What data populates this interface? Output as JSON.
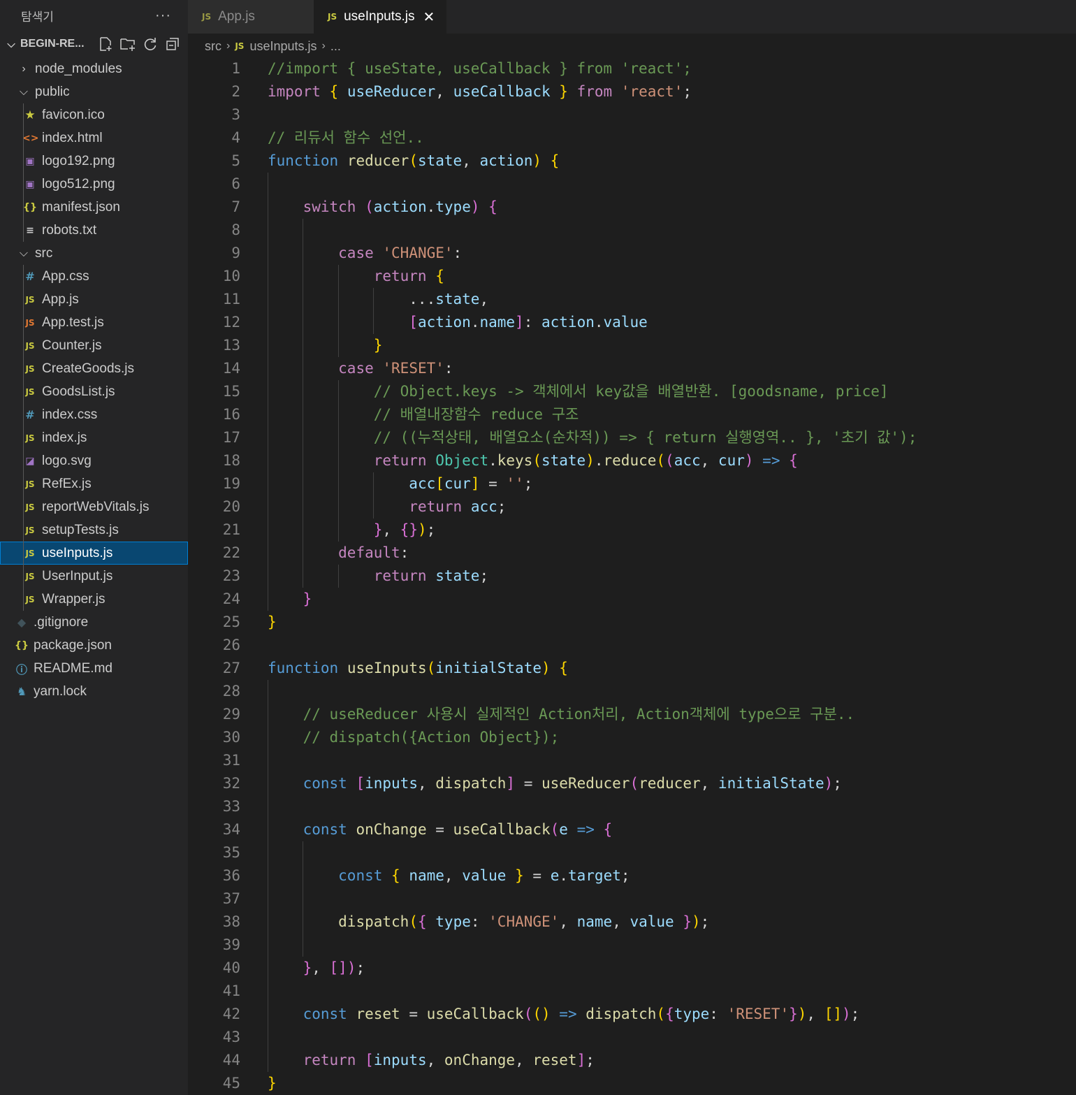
{
  "sidebar": {
    "title": "탐색기",
    "more": "···",
    "project": "BEGIN-RE...",
    "items": [
      {
        "name": "node_modules",
        "type": "folder-closed",
        "depth": 1,
        "icon": "chevron-right-icon"
      },
      {
        "name": "public",
        "type": "folder-open",
        "depth": 1,
        "icon": "chevron-down-icon"
      },
      {
        "name": "favicon.ico",
        "type": "star",
        "depth": 2,
        "icon": "star-icon"
      },
      {
        "name": "index.html",
        "type": "html",
        "depth": 2,
        "icon": "html-icon"
      },
      {
        "name": "logo192.png",
        "type": "img",
        "depth": 2,
        "icon": "image-icon"
      },
      {
        "name": "logo512.png",
        "type": "img",
        "depth": 2,
        "icon": "image-icon"
      },
      {
        "name": "manifest.json",
        "type": "json",
        "depth": 2,
        "icon": "json-icon"
      },
      {
        "name": "robots.txt",
        "type": "txt",
        "depth": 2,
        "icon": "text-file-icon"
      },
      {
        "name": "src",
        "type": "folder-open",
        "depth": 1,
        "icon": "chevron-down-icon"
      },
      {
        "name": "App.css",
        "type": "css",
        "depth": 2,
        "icon": "css-icon"
      },
      {
        "name": "App.js",
        "type": "js",
        "depth": 2,
        "icon": "js-icon"
      },
      {
        "name": "App.test.js",
        "type": "jstest",
        "depth": 2,
        "icon": "js-icon"
      },
      {
        "name": "Counter.js",
        "type": "js",
        "depth": 2,
        "icon": "js-icon"
      },
      {
        "name": "CreateGoods.js",
        "type": "js",
        "depth": 2,
        "icon": "js-icon"
      },
      {
        "name": "GoodsList.js",
        "type": "js",
        "depth": 2,
        "icon": "js-icon"
      },
      {
        "name": "index.css",
        "type": "css",
        "depth": 2,
        "icon": "css-icon"
      },
      {
        "name": "index.js",
        "type": "js",
        "depth": 2,
        "icon": "js-icon"
      },
      {
        "name": "logo.svg",
        "type": "svg",
        "depth": 2,
        "icon": "svg-icon"
      },
      {
        "name": "RefEx.js",
        "type": "js",
        "depth": 2,
        "icon": "js-icon"
      },
      {
        "name": "reportWebVitals.js",
        "type": "js",
        "depth": 2,
        "icon": "js-icon"
      },
      {
        "name": "setupTests.js",
        "type": "js",
        "depth": 2,
        "icon": "js-icon"
      },
      {
        "name": "useInputs.js",
        "type": "js",
        "depth": 2,
        "icon": "js-icon",
        "selected": true
      },
      {
        "name": "UserInput.js",
        "type": "js",
        "depth": 2,
        "icon": "js-icon"
      },
      {
        "name": "Wrapper.js",
        "type": "js",
        "depth": 2,
        "icon": "js-icon"
      },
      {
        "name": ".gitignore",
        "type": "git",
        "depth": 1,
        "icon": "git-icon"
      },
      {
        "name": "package.json",
        "type": "json",
        "depth": 1,
        "icon": "json-icon"
      },
      {
        "name": "README.md",
        "type": "info",
        "depth": 1,
        "icon": "info-icon"
      },
      {
        "name": "yarn.lock",
        "type": "yarn",
        "depth": 1,
        "icon": "yarn-icon"
      }
    ]
  },
  "tabs": [
    {
      "label": "App.js",
      "icon": "JS",
      "active": false
    },
    {
      "label": "useInputs.js",
      "icon": "JS",
      "active": true,
      "close": "✕"
    }
  ],
  "breadcrumb": {
    "folder": "src",
    "icon": "JS",
    "file": "useInputs.js",
    "more": "..."
  },
  "editor": {
    "lines": [
      [
        [
          "cm",
          "//import { useState, useCallback } from 'react';"
        ]
      ],
      [
        [
          "c",
          "import"
        ],
        [
          "p",
          " "
        ],
        [
          "y",
          "{"
        ],
        [
          "p",
          " "
        ],
        [
          "v",
          "useReducer"
        ],
        [
          "p",
          ", "
        ],
        [
          "v",
          "useCallback"
        ],
        [
          "p",
          " "
        ],
        [
          "y",
          "}"
        ],
        [
          "p",
          " "
        ],
        [
          "c",
          "from"
        ],
        [
          "p",
          " "
        ],
        [
          "s",
          "'react'"
        ],
        [
          "p",
          ";"
        ]
      ],
      [],
      [
        [
          "cm",
          "// 리듀서 함수 선언.."
        ]
      ],
      [
        [
          "k",
          "function"
        ],
        [
          "p",
          " "
        ],
        [
          "f",
          "reducer"
        ],
        [
          "y",
          "("
        ],
        [
          "v",
          "state"
        ],
        [
          "p",
          ", "
        ],
        [
          "v",
          "action"
        ],
        [
          "y",
          ")"
        ],
        [
          "p",
          " "
        ],
        [
          "y",
          "{"
        ]
      ],
      [],
      [
        [
          "p",
          "    "
        ],
        [
          "c",
          "switch"
        ],
        [
          "p",
          " "
        ],
        [
          "m",
          "("
        ],
        [
          "v",
          "action"
        ],
        [
          "p",
          "."
        ],
        [
          "v",
          "type"
        ],
        [
          "m",
          ")"
        ],
        [
          "p",
          " "
        ],
        [
          "m",
          "{"
        ]
      ],
      [],
      [
        [
          "p",
          "        "
        ],
        [
          "c",
          "case"
        ],
        [
          "p",
          " "
        ],
        [
          "s",
          "'CHANGE'"
        ],
        [
          "p",
          ":"
        ]
      ],
      [
        [
          "p",
          "            "
        ],
        [
          "c",
          "return"
        ],
        [
          "p",
          " "
        ],
        [
          "y",
          "{"
        ]
      ],
      [
        [
          "p",
          "                ..."
        ],
        [
          "v",
          "state"
        ],
        [
          "p",
          ","
        ]
      ],
      [
        [
          "p",
          "                "
        ],
        [
          "m",
          "["
        ],
        [
          "v",
          "action"
        ],
        [
          "p",
          "."
        ],
        [
          "v",
          "name"
        ],
        [
          "m",
          "]"
        ],
        [
          "p",
          ": "
        ],
        [
          "v",
          "action"
        ],
        [
          "p",
          "."
        ],
        [
          "v",
          "value"
        ]
      ],
      [
        [
          "p",
          "            "
        ],
        [
          "y",
          "}"
        ]
      ],
      [
        [
          "p",
          "        "
        ],
        [
          "c",
          "case"
        ],
        [
          "p",
          " "
        ],
        [
          "s",
          "'RESET'"
        ],
        [
          "p",
          ":"
        ]
      ],
      [
        [
          "p",
          "            "
        ],
        [
          "cm",
          "// Object.keys -> 객체에서 key값을 배열반환. [goodsname, price]"
        ]
      ],
      [
        [
          "p",
          "            "
        ],
        [
          "cm",
          "// 배열내장함수 reduce 구조"
        ]
      ],
      [
        [
          "p",
          "            "
        ],
        [
          "cm",
          "// ((누적상태, 배열요소(순차적)) => { return 실행영역.. }, '초기 값');"
        ]
      ],
      [
        [
          "p",
          "            "
        ],
        [
          "c",
          "return"
        ],
        [
          "p",
          " "
        ],
        [
          "t",
          "Object"
        ],
        [
          "p",
          "."
        ],
        [
          "f",
          "keys"
        ],
        [
          "y",
          "("
        ],
        [
          "v",
          "state"
        ],
        [
          "y",
          ")"
        ],
        [
          "p",
          "."
        ],
        [
          "f",
          "reduce"
        ],
        [
          "y",
          "("
        ],
        [
          "m",
          "("
        ],
        [
          "v",
          "acc"
        ],
        [
          "p",
          ", "
        ],
        [
          "v",
          "cur"
        ],
        [
          "m",
          ")"
        ],
        [
          "p",
          " "
        ],
        [
          "k",
          "=>"
        ],
        [
          "p",
          " "
        ],
        [
          "m",
          "{"
        ]
      ],
      [
        [
          "p",
          "                "
        ],
        [
          "v",
          "acc"
        ],
        [
          "y",
          "["
        ],
        [
          "v",
          "cur"
        ],
        [
          "y",
          "]"
        ],
        [
          "p",
          " = "
        ],
        [
          "s",
          "''"
        ],
        [
          "p",
          ";"
        ]
      ],
      [
        [
          "p",
          "                "
        ],
        [
          "c",
          "return"
        ],
        [
          "p",
          " "
        ],
        [
          "v",
          "acc"
        ],
        [
          "p",
          ";"
        ]
      ],
      [
        [
          "p",
          "            "
        ],
        [
          "m",
          "}"
        ],
        [
          "p",
          ", "
        ],
        [
          "m",
          "{}"
        ],
        [
          "y",
          ")"
        ],
        [
          "p",
          ";"
        ]
      ],
      [
        [
          "p",
          "        "
        ],
        [
          "c",
          "default"
        ],
        [
          "p",
          ":"
        ]
      ],
      [
        [
          "p",
          "            "
        ],
        [
          "c",
          "return"
        ],
        [
          "p",
          " "
        ],
        [
          "v",
          "state"
        ],
        [
          "p",
          ";"
        ]
      ],
      [
        [
          "p",
          "    "
        ],
        [
          "m",
          "}"
        ]
      ],
      [
        [
          "y",
          "}"
        ]
      ],
      [],
      [
        [
          "k",
          "function"
        ],
        [
          "p",
          " "
        ],
        [
          "f",
          "useInputs"
        ],
        [
          "y",
          "("
        ],
        [
          "v",
          "initialState"
        ],
        [
          "y",
          ")"
        ],
        [
          "p",
          " "
        ],
        [
          "y",
          "{"
        ]
      ],
      [],
      [
        [
          "p",
          "    "
        ],
        [
          "cm",
          "// useReducer 사용시 실제적인 Action처리, Action객체에 type으로 구분.."
        ]
      ],
      [
        [
          "p",
          "    "
        ],
        [
          "cm",
          "// dispatch({Action Object});"
        ]
      ],
      [],
      [
        [
          "p",
          "    "
        ],
        [
          "k",
          "const"
        ],
        [
          "p",
          " "
        ],
        [
          "m",
          "["
        ],
        [
          "v",
          "inputs"
        ],
        [
          "p",
          ", "
        ],
        [
          "f",
          "dispatch"
        ],
        [
          "m",
          "]"
        ],
        [
          "p",
          " = "
        ],
        [
          "f",
          "useReducer"
        ],
        [
          "m",
          "("
        ],
        [
          "f",
          "reducer"
        ],
        [
          "p",
          ", "
        ],
        [
          "v",
          "initialState"
        ],
        [
          "m",
          ")"
        ],
        [
          "p",
          ";"
        ]
      ],
      [],
      [
        [
          "p",
          "    "
        ],
        [
          "k",
          "const"
        ],
        [
          "p",
          " "
        ],
        [
          "f",
          "onChange"
        ],
        [
          "p",
          " = "
        ],
        [
          "f",
          "useCallback"
        ],
        [
          "m",
          "("
        ],
        [
          "v",
          "e"
        ],
        [
          "p",
          " "
        ],
        [
          "k",
          "=>"
        ],
        [
          "p",
          " "
        ],
        [
          "m",
          "{"
        ]
      ],
      [],
      [
        [
          "p",
          "        "
        ],
        [
          "k",
          "const"
        ],
        [
          "p",
          " "
        ],
        [
          "y",
          "{"
        ],
        [
          "p",
          " "
        ],
        [
          "v",
          "name"
        ],
        [
          "p",
          ", "
        ],
        [
          "v",
          "value"
        ],
        [
          "p",
          " "
        ],
        [
          "y",
          "}"
        ],
        [
          "p",
          " = "
        ],
        [
          "v",
          "e"
        ],
        [
          "p",
          "."
        ],
        [
          "v",
          "target"
        ],
        [
          "p",
          ";"
        ]
      ],
      [],
      [
        [
          "p",
          "        "
        ],
        [
          "f",
          "dispatch"
        ],
        [
          "y",
          "("
        ],
        [
          "m",
          "{"
        ],
        [
          "p",
          " "
        ],
        [
          "v",
          "type"
        ],
        [
          "p",
          ": "
        ],
        [
          "s",
          "'CHANGE'"
        ],
        [
          "p",
          ", "
        ],
        [
          "v",
          "name"
        ],
        [
          "p",
          ", "
        ],
        [
          "v",
          "value"
        ],
        [
          "p",
          " "
        ],
        [
          "m",
          "}"
        ],
        [
          "y",
          ")"
        ],
        [
          "p",
          ";"
        ]
      ],
      [],
      [
        [
          "p",
          "    "
        ],
        [
          "m",
          "}"
        ],
        [
          "p",
          ", "
        ],
        [
          "m",
          "[]"
        ],
        [
          "m",
          ")"
        ],
        [
          "p",
          ";"
        ]
      ],
      [],
      [
        [
          "p",
          "    "
        ],
        [
          "k",
          "const"
        ],
        [
          "p",
          " "
        ],
        [
          "f",
          "reset"
        ],
        [
          "p",
          " = "
        ],
        [
          "f",
          "useCallback"
        ],
        [
          "m",
          "("
        ],
        [
          "y",
          "()"
        ],
        [
          "p",
          " "
        ],
        [
          "k",
          "=>"
        ],
        [
          "p",
          " "
        ],
        [
          "f",
          "dispatch"
        ],
        [
          "y",
          "("
        ],
        [
          "m",
          "{"
        ],
        [
          "v",
          "type"
        ],
        [
          "p",
          ": "
        ],
        [
          "s",
          "'RESET'"
        ],
        [
          "m",
          "}"
        ],
        [
          "y",
          ")"
        ],
        [
          "p",
          ", "
        ],
        [
          "y",
          "[]"
        ],
        [
          "m",
          ")"
        ],
        [
          "p",
          ";"
        ]
      ],
      [],
      [
        [
          "p",
          "    "
        ],
        [
          "c",
          "return"
        ],
        [
          "p",
          " "
        ],
        [
          "m",
          "["
        ],
        [
          "v",
          "inputs"
        ],
        [
          "p",
          ", "
        ],
        [
          "f",
          "onChange"
        ],
        [
          "p",
          ", "
        ],
        [
          "f",
          "reset"
        ],
        [
          "m",
          "]"
        ],
        [
          "p",
          ";"
        ]
      ],
      [
        [
          "y",
          "}"
        ]
      ]
    ]
  }
}
